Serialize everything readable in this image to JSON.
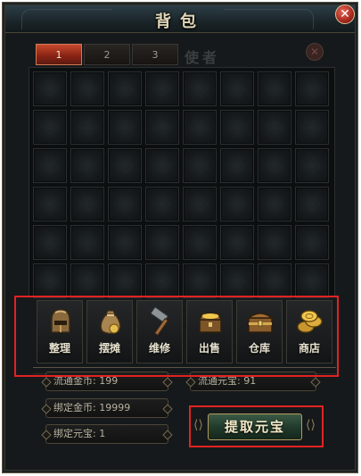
{
  "window": {
    "title": "背包"
  },
  "tabs": [
    {
      "label": "1",
      "active": true
    },
    {
      "label": "2",
      "active": false
    },
    {
      "label": "3",
      "active": false
    }
  ],
  "background_text": "使者",
  "grid": {
    "rows": 6,
    "cols": 8
  },
  "actions": [
    {
      "label": "整理",
      "icon": "helmet-icon"
    },
    {
      "label": "摆摊",
      "icon": "money-bag-icon"
    },
    {
      "label": "维修",
      "icon": "hammer-icon"
    },
    {
      "label": "出售",
      "icon": "treasure-chest-icon"
    },
    {
      "label": "仓库",
      "icon": "storage-chest-icon"
    },
    {
      "label": "商店",
      "icon": "gold-coins-icon"
    }
  ],
  "currency": {
    "circulating_gold": "流通金币: 199",
    "circulating_yuanbao": "流通元宝: 91",
    "bound_gold": "绑定金币: 19999",
    "bound_yuanbao": "绑定元宝: 1"
  },
  "withdraw_button": "提取元宝",
  "colors": {
    "highlight": "#e32222",
    "active_tab": "#8c2414",
    "button": "#223b2c"
  }
}
